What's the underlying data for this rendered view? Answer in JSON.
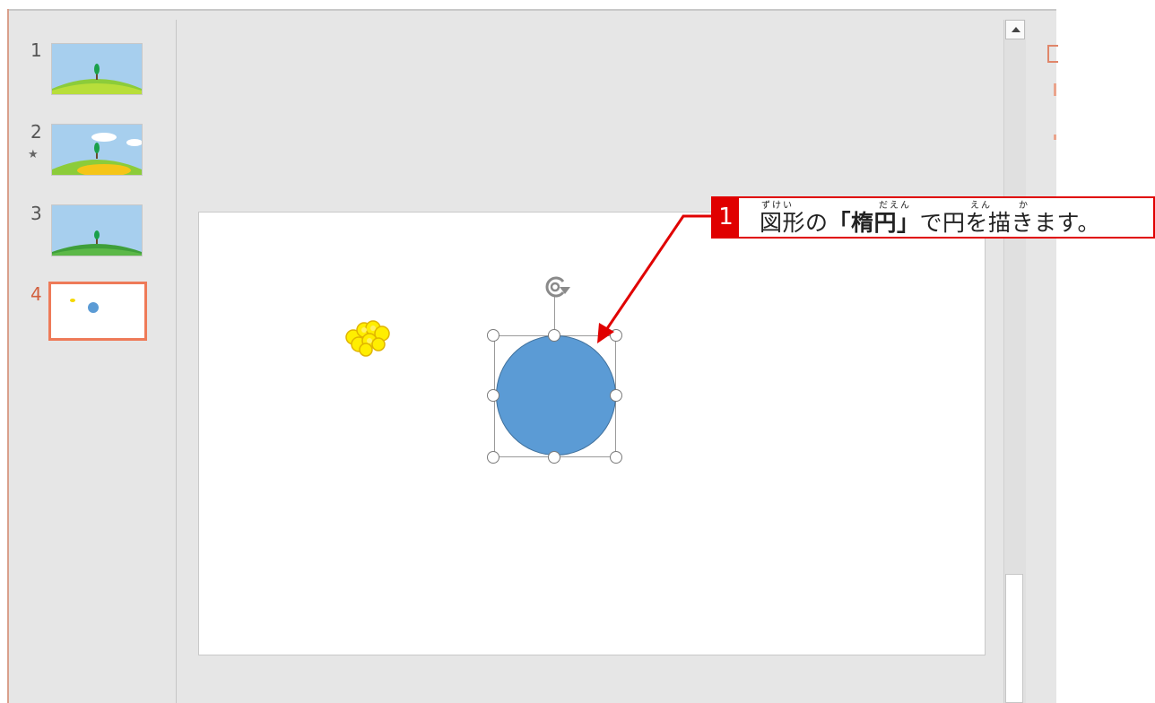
{
  "thumbnails": [
    {
      "number": "1",
      "star": ""
    },
    {
      "number": "2",
      "star": "★"
    },
    {
      "number": "3",
      "star": ""
    },
    {
      "number": "4",
      "star": ""
    }
  ],
  "callout": {
    "number": "1",
    "text_before": "図形の",
    "text_bold": "「楕円」",
    "text_after": "で円を描きます。",
    "furigana": [
      "ずけい",
      "だえん",
      "えん",
      "か"
    ],
    "color": "#e00000"
  },
  "shape": {
    "fill_color": "#5b9bd5"
  },
  "icons": [
    "rotate-handle-icon",
    "scroll-up-arrow-icon",
    "flowers-image"
  ]
}
